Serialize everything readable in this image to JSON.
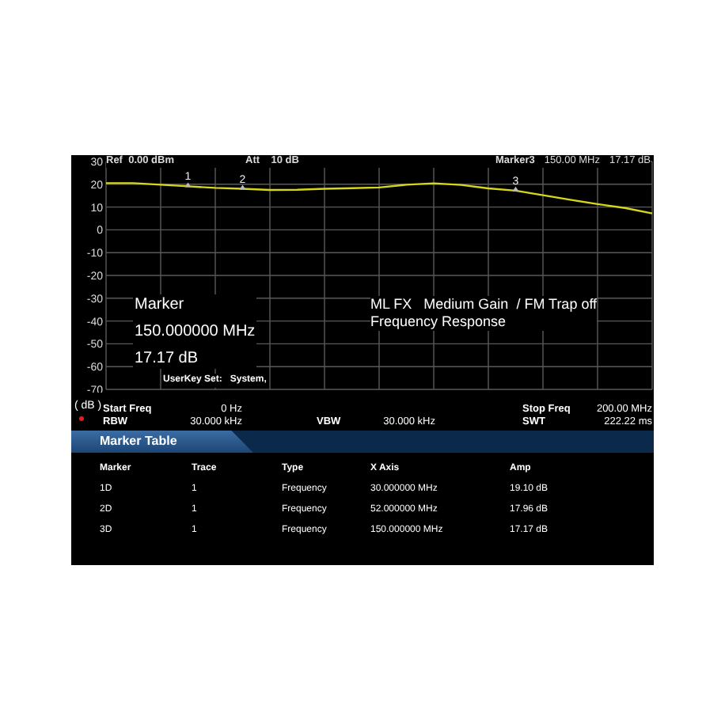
{
  "header": {
    "ref": "Ref  0.00 dBm",
    "att": "Att    10 dB",
    "marker": "Marker3",
    "marker_freq": "150.00 MHz",
    "marker_amp": "17.17 dB"
  },
  "plot": {
    "marker_labels": [
      "1",
      "2",
      "3"
    ],
    "chart_data": {
      "type": "line",
      "grid": true,
      "ylabel": "( dB )",
      "ylim": [
        -70,
        30
      ],
      "yticks": [
        30,
        20,
        10,
        0,
        -10,
        -20,
        -30,
        -40,
        -50,
        -60,
        -70
      ],
      "categories": [
        null,
        null,
        null,
        null,
        null,
        null,
        null,
        null,
        null,
        null,
        null,
        null,
        null,
        null,
        null,
        null,
        null,
        null,
        null,
        null,
        null
      ],
      "series": [
        {
          "color": "#d6d61a",
          "values": [
            20.5,
            20.5,
            19.8,
            19.1,
            18.4,
            18.0,
            17.5,
            17.6,
            18.0,
            18.3,
            18.6,
            19.8,
            20.4,
            19.7,
            18.2,
            17.2,
            15.2,
            13.2,
            11.3,
            9.6,
            7.2
          ]
        }
      ]
    }
  },
  "overlay": {
    "marker_lines": [
      "Marker",
      "150.000000 MHz",
      "17.17 dB"
    ],
    "userkey": "UserKey Set:   System,",
    "info_lines": [
      "ML FX   Medium Gain  / FM Trap off",
      "Frequency Response"
    ]
  },
  "status": {
    "start": {
      "label": "Start Freq",
      "value": "0 Hz"
    },
    "stop": {
      "label": "Stop Freq",
      "value": "200.00 MHz"
    },
    "rbw": {
      "label": "RBW",
      "value": "30.000 kHz"
    },
    "vbw": {
      "label": "VBW",
      "value": "30.000 kHz"
    },
    "swt": {
      "label": "SWT",
      "value": "222.22 ms"
    }
  },
  "marker_table": {
    "title": "Marker Table",
    "columns": [
      "Marker",
      "Trace",
      "Type",
      "X Axis",
      "Amp"
    ],
    "rows": [
      [
        "1D",
        "1",
        "Frequency",
        "30.000000 MHz",
        "19.10 dB"
      ],
      [
        "2D",
        "1",
        "Frequency",
        "52.000000 MHz",
        "17.96 dB"
      ],
      [
        "3D",
        "1",
        "Frequency",
        "150.000000 MHz",
        "17.17 dB"
      ]
    ]
  }
}
